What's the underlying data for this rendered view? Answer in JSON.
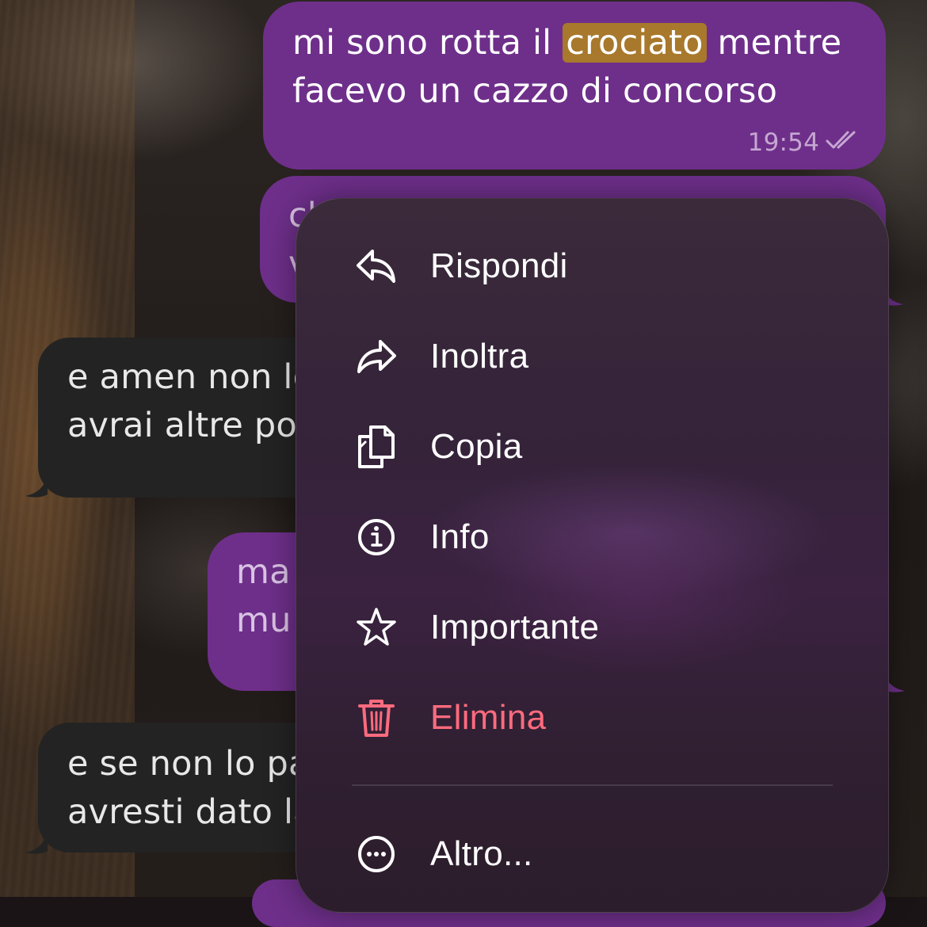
{
  "messages": [
    {
      "direction": "out",
      "text_before": "mi sono rotta il ",
      "highlight": "crociato",
      "text_after": " mentre",
      "line2": "facevo un cazzo di concorso",
      "time": "19:54",
      "status": "read"
    },
    {
      "direction": "out",
      "line1": "ch",
      "line2": "v"
    },
    {
      "direction": "in",
      "line1": "e amen non lo",
      "line2": "avrai altre pos"
    },
    {
      "direction": "out",
      "line1": "ma",
      "line2": "mu"
    },
    {
      "direction": "in",
      "line1": "e se non lo pa",
      "line2": "avresti dato la"
    }
  ],
  "context_menu": {
    "items": [
      {
        "label": "Rispondi",
        "icon": "reply-icon"
      },
      {
        "label": "Inoltra",
        "icon": "forward-icon"
      },
      {
        "label": "Copia",
        "icon": "copy-icon"
      },
      {
        "label": "Info",
        "icon": "info-icon"
      },
      {
        "label": "Importante",
        "icon": "star-icon"
      },
      {
        "label": "Elimina",
        "icon": "trash-icon",
        "color": "#ff6b7e"
      },
      {
        "label": "Altro...",
        "icon": "more-icon"
      }
    ]
  },
  "colors": {
    "outgoing_bubble": "#6e2f8a",
    "incoming_bubble": "#232323",
    "highlight": "#a8782c",
    "danger": "#ff6b7e"
  }
}
